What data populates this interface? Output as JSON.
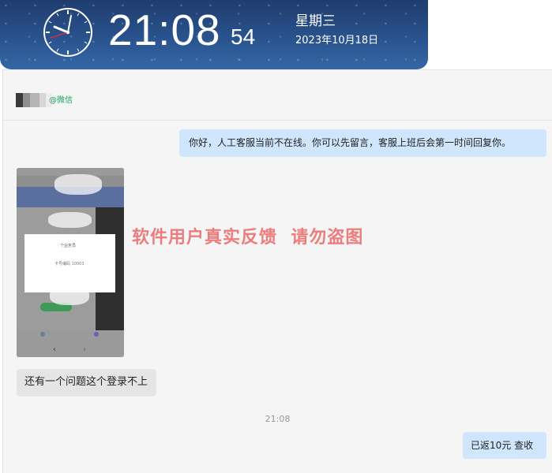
{
  "clock": {
    "hours_minutes": "21:08",
    "seconds": "54",
    "weekday": "星期三",
    "date": "2023年10月18日"
  },
  "chat": {
    "contact_source": "@微信",
    "messages": [
      {
        "sender": "agent",
        "text": "你好，人工客服当前不在线。你可以先留言，客服上班后会第一时间回复你。"
      },
      {
        "sender": "user",
        "type": "image"
      },
      {
        "sender": "user",
        "text": "还有一个问题这个登录不上"
      },
      {
        "type": "timestamp",
        "text": "21:08"
      },
      {
        "sender": "agent",
        "text": "已返10元 查收"
      }
    ],
    "thumbnail": {
      "dialog_title": "个业务员",
      "dialog_text": "卡号编码 10003"
    }
  },
  "watermark": "软件用户真实反馈  请勿盗图",
  "colors": {
    "clock_background": "#2a5590",
    "outgoing_bubble": "#cfe6fd",
    "incoming_bubble": "#e5e5e5",
    "wechat_green": "#1aa260",
    "watermark": "#ec7d7d"
  }
}
